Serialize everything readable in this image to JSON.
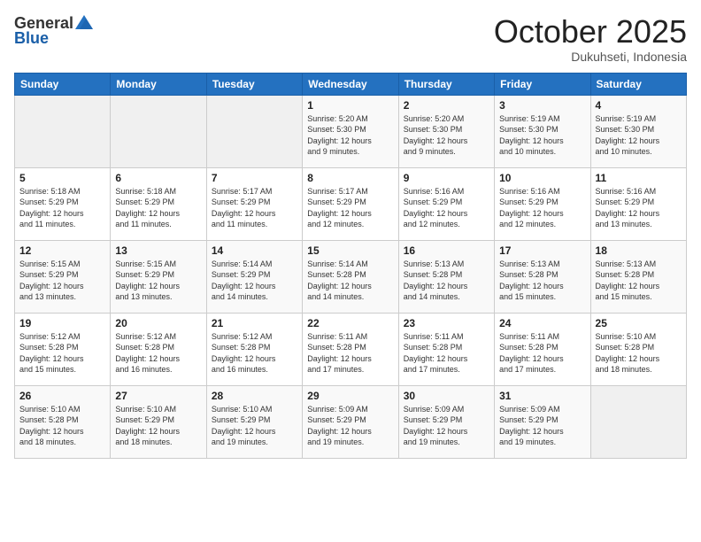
{
  "header": {
    "logo_general": "General",
    "logo_blue": "Blue",
    "month": "October 2025",
    "location": "Dukuhseti, Indonesia"
  },
  "weekdays": [
    "Sunday",
    "Monday",
    "Tuesday",
    "Wednesday",
    "Thursday",
    "Friday",
    "Saturday"
  ],
  "weeks": [
    [
      {
        "day": "",
        "info": ""
      },
      {
        "day": "",
        "info": ""
      },
      {
        "day": "",
        "info": ""
      },
      {
        "day": "1",
        "info": "Sunrise: 5:20 AM\nSunset: 5:30 PM\nDaylight: 12 hours\nand 9 minutes."
      },
      {
        "day": "2",
        "info": "Sunrise: 5:20 AM\nSunset: 5:30 PM\nDaylight: 12 hours\nand 9 minutes."
      },
      {
        "day": "3",
        "info": "Sunrise: 5:19 AM\nSunset: 5:30 PM\nDaylight: 12 hours\nand 10 minutes."
      },
      {
        "day": "4",
        "info": "Sunrise: 5:19 AM\nSunset: 5:30 PM\nDaylight: 12 hours\nand 10 minutes."
      }
    ],
    [
      {
        "day": "5",
        "info": "Sunrise: 5:18 AM\nSunset: 5:29 PM\nDaylight: 12 hours\nand 11 minutes."
      },
      {
        "day": "6",
        "info": "Sunrise: 5:18 AM\nSunset: 5:29 PM\nDaylight: 12 hours\nand 11 minutes."
      },
      {
        "day": "7",
        "info": "Sunrise: 5:17 AM\nSunset: 5:29 PM\nDaylight: 12 hours\nand 11 minutes."
      },
      {
        "day": "8",
        "info": "Sunrise: 5:17 AM\nSunset: 5:29 PM\nDaylight: 12 hours\nand 12 minutes."
      },
      {
        "day": "9",
        "info": "Sunrise: 5:16 AM\nSunset: 5:29 PM\nDaylight: 12 hours\nand 12 minutes."
      },
      {
        "day": "10",
        "info": "Sunrise: 5:16 AM\nSunset: 5:29 PM\nDaylight: 12 hours\nand 12 minutes."
      },
      {
        "day": "11",
        "info": "Sunrise: 5:16 AM\nSunset: 5:29 PM\nDaylight: 12 hours\nand 13 minutes."
      }
    ],
    [
      {
        "day": "12",
        "info": "Sunrise: 5:15 AM\nSunset: 5:29 PM\nDaylight: 12 hours\nand 13 minutes."
      },
      {
        "day": "13",
        "info": "Sunrise: 5:15 AM\nSunset: 5:29 PM\nDaylight: 12 hours\nand 13 minutes."
      },
      {
        "day": "14",
        "info": "Sunrise: 5:14 AM\nSunset: 5:29 PM\nDaylight: 12 hours\nand 14 minutes."
      },
      {
        "day": "15",
        "info": "Sunrise: 5:14 AM\nSunset: 5:28 PM\nDaylight: 12 hours\nand 14 minutes."
      },
      {
        "day": "16",
        "info": "Sunrise: 5:13 AM\nSunset: 5:28 PM\nDaylight: 12 hours\nand 14 minutes."
      },
      {
        "day": "17",
        "info": "Sunrise: 5:13 AM\nSunset: 5:28 PM\nDaylight: 12 hours\nand 15 minutes."
      },
      {
        "day": "18",
        "info": "Sunrise: 5:13 AM\nSunset: 5:28 PM\nDaylight: 12 hours\nand 15 minutes."
      }
    ],
    [
      {
        "day": "19",
        "info": "Sunrise: 5:12 AM\nSunset: 5:28 PM\nDaylight: 12 hours\nand 15 minutes."
      },
      {
        "day": "20",
        "info": "Sunrise: 5:12 AM\nSunset: 5:28 PM\nDaylight: 12 hours\nand 16 minutes."
      },
      {
        "day": "21",
        "info": "Sunrise: 5:12 AM\nSunset: 5:28 PM\nDaylight: 12 hours\nand 16 minutes."
      },
      {
        "day": "22",
        "info": "Sunrise: 5:11 AM\nSunset: 5:28 PM\nDaylight: 12 hours\nand 17 minutes."
      },
      {
        "day": "23",
        "info": "Sunrise: 5:11 AM\nSunset: 5:28 PM\nDaylight: 12 hours\nand 17 minutes."
      },
      {
        "day": "24",
        "info": "Sunrise: 5:11 AM\nSunset: 5:28 PM\nDaylight: 12 hours\nand 17 minutes."
      },
      {
        "day": "25",
        "info": "Sunrise: 5:10 AM\nSunset: 5:28 PM\nDaylight: 12 hours\nand 18 minutes."
      }
    ],
    [
      {
        "day": "26",
        "info": "Sunrise: 5:10 AM\nSunset: 5:28 PM\nDaylight: 12 hours\nand 18 minutes."
      },
      {
        "day": "27",
        "info": "Sunrise: 5:10 AM\nSunset: 5:29 PM\nDaylight: 12 hours\nand 18 minutes."
      },
      {
        "day": "28",
        "info": "Sunrise: 5:10 AM\nSunset: 5:29 PM\nDaylight: 12 hours\nand 19 minutes."
      },
      {
        "day": "29",
        "info": "Sunrise: 5:09 AM\nSunset: 5:29 PM\nDaylight: 12 hours\nand 19 minutes."
      },
      {
        "day": "30",
        "info": "Sunrise: 5:09 AM\nSunset: 5:29 PM\nDaylight: 12 hours\nand 19 minutes."
      },
      {
        "day": "31",
        "info": "Sunrise: 5:09 AM\nSunset: 5:29 PM\nDaylight: 12 hours\nand 19 minutes."
      },
      {
        "day": "",
        "info": ""
      }
    ]
  ]
}
